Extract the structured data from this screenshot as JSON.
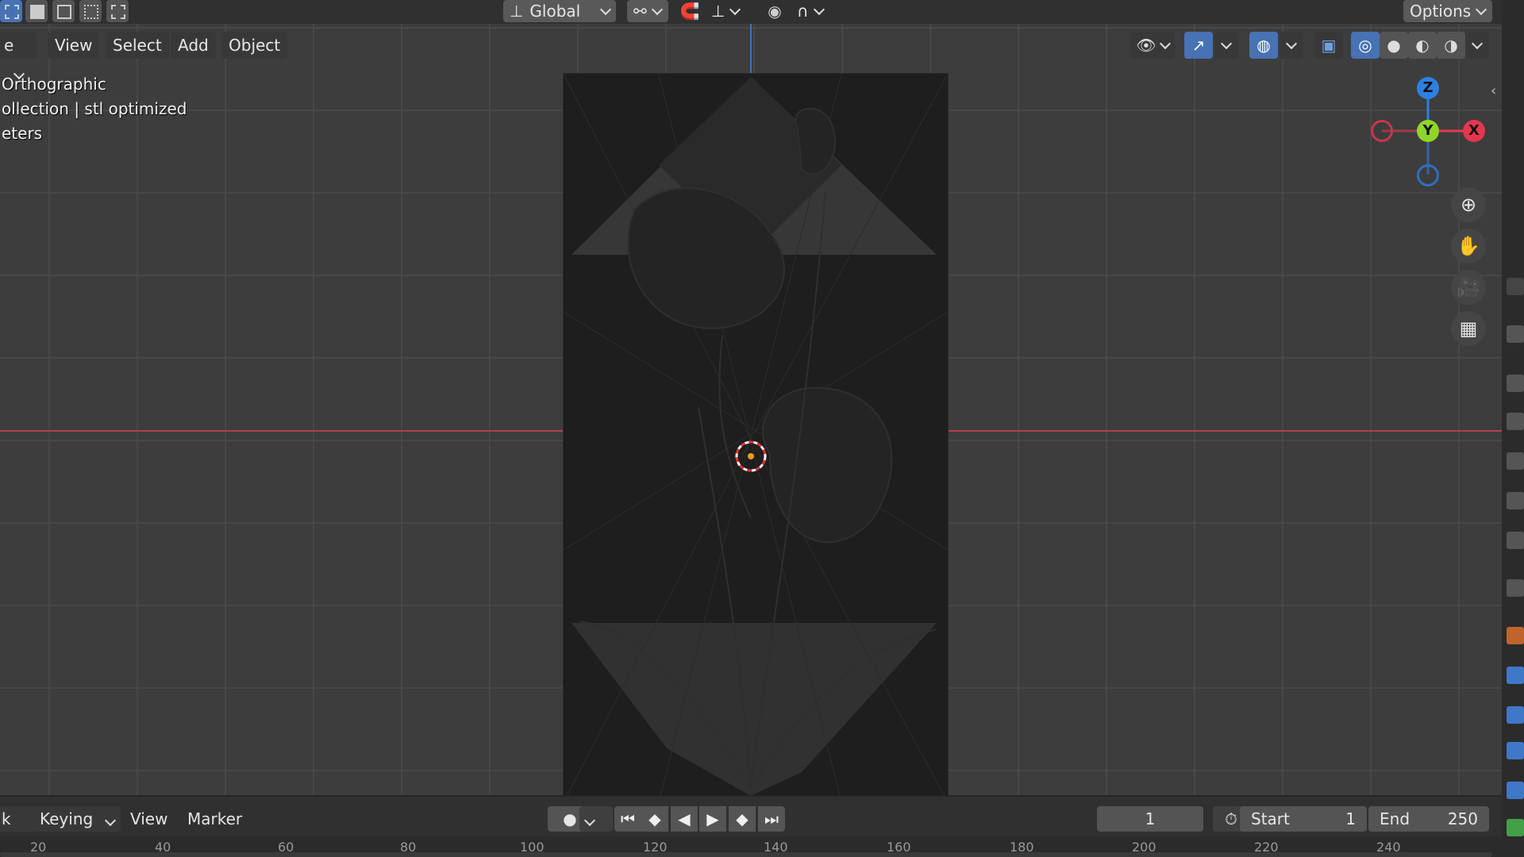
{
  "topbar": {
    "transform_orientation": "Global",
    "options_label": "Options"
  },
  "viewport_header": {
    "mode_label_partial": "e",
    "menu": [
      "View",
      "Select",
      "Add",
      "Object"
    ]
  },
  "overlay": {
    "view_name": "Orthographic",
    "collection_text": "ollection | stl optimized",
    "units_text": "eters"
  },
  "gizmo": {
    "z_label": "Z",
    "y_label": "Y",
    "x_label": "X"
  },
  "timeline": {
    "playback_label_partial": "k",
    "keying_label": "Keying",
    "view_label": "View",
    "marker_label": "Marker",
    "current_frame": "1",
    "start_label": "Start",
    "start_value": "1",
    "end_label": "End",
    "end_value": "250",
    "ruler_numbers": [
      "20",
      "40",
      "60",
      "80",
      "100",
      "120",
      "140",
      "160",
      "180",
      "200",
      "220",
      "240"
    ]
  },
  "colors": {
    "accent_blue": "#4772b3",
    "x_axis": "#e5374e",
    "y_axis": "#8fd629",
    "z_axis": "#2f7fe0",
    "viewport_bg": "#3d3d3d"
  }
}
